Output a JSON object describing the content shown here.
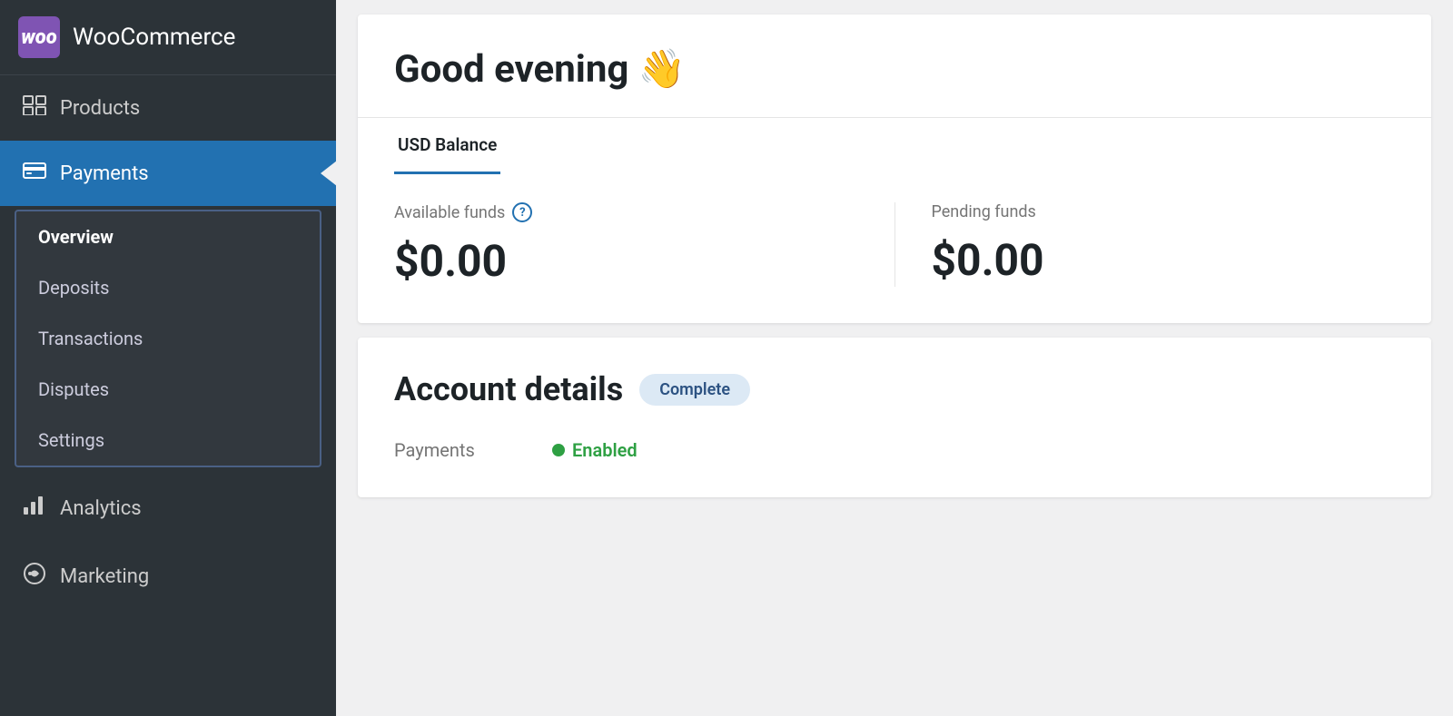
{
  "sidebar": {
    "brand": {
      "logo_label": "woo",
      "name": "WooCommerce"
    },
    "items": [
      {
        "id": "products",
        "label": "Products",
        "icon": "products-icon"
      },
      {
        "id": "payments",
        "label": "Payments",
        "icon": "payments-icon",
        "active": true
      },
      {
        "id": "analytics",
        "label": "Analytics",
        "icon": "analytics-icon"
      },
      {
        "id": "marketing",
        "label": "Marketing",
        "icon": "marketing-icon"
      }
    ],
    "payments_submenu": [
      {
        "id": "overview",
        "label": "Overview",
        "active": true
      },
      {
        "id": "deposits",
        "label": "Deposits"
      },
      {
        "id": "transactions",
        "label": "Transactions"
      },
      {
        "id": "disputes",
        "label": "Disputes"
      },
      {
        "id": "settings",
        "label": "Settings"
      }
    ]
  },
  "main": {
    "greeting": "Good evening 👋",
    "balance_tab": "USD Balance",
    "available_funds_label": "Available funds",
    "available_funds_amount": "$0.00",
    "pending_funds_label": "Pending funds",
    "pending_funds_amount": "$0.00",
    "account_details_title": "Account details",
    "account_status_badge": "Complete",
    "account_row_label": "Payments",
    "account_row_value": "Enabled"
  },
  "colors": {
    "active_blue": "#2271b1",
    "sidebar_bg": "#2c3338",
    "enabled_green": "#2ea043",
    "complete_badge_bg": "#dce9f5",
    "complete_badge_text": "#2c5282"
  }
}
